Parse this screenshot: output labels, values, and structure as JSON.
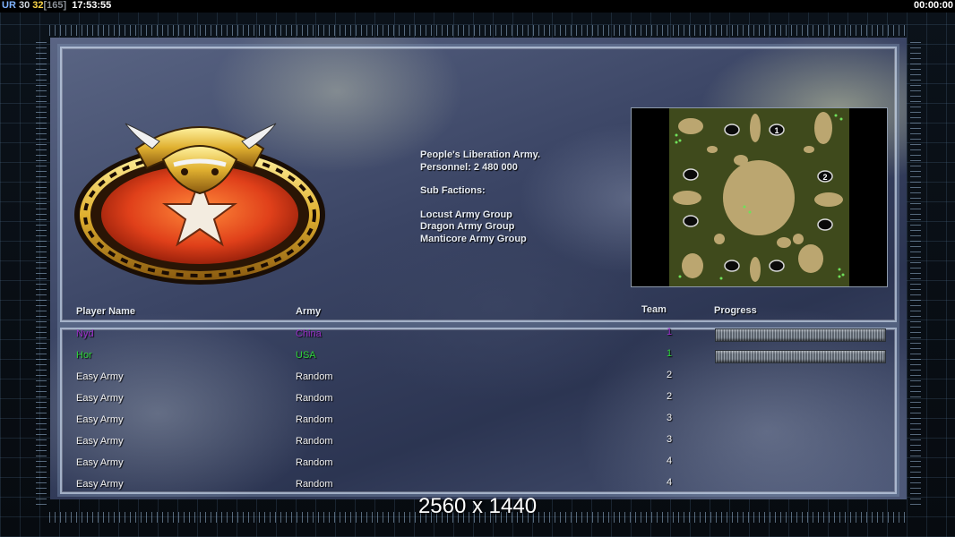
{
  "overlay": {
    "ur_label": "UR",
    "fps": "30",
    "fps_cap": "32",
    "cap_bracket": "[165]",
    "clock": "17:53:55",
    "game_timer": "00:00:00"
  },
  "faction": {
    "name": "People's Liberation Army.",
    "personnel": "Personnel: 2 480 000",
    "sub_factions_title": "Sub Factions:",
    "sub_factions": [
      "Locust Army Group",
      "Dragon Army Group",
      "Manticore Army Group"
    ]
  },
  "minimap": {
    "start_markers": [
      "1",
      "2"
    ]
  },
  "table": {
    "headers": {
      "player": "Player Name",
      "army": "Army",
      "team": "Team",
      "progress": "Progress"
    },
    "rows": [
      {
        "name": "Nyd",
        "army": "China",
        "team": "1",
        "color": "#9b2fc9",
        "progress": 1.0
      },
      {
        "name": "Hor",
        "army": "USA",
        "team": "1",
        "color": "#2fd43a",
        "progress": 1.0
      },
      {
        "name": "Easy Army",
        "army": "Random",
        "team": "2",
        "color": "#f2f2f2"
      },
      {
        "name": "Easy Army",
        "army": "Random",
        "team": "2",
        "color": "#f2f2f2"
      },
      {
        "name": "Easy Army",
        "army": "Random",
        "team": "3",
        "color": "#f2f2f2"
      },
      {
        "name": "Easy Army",
        "army": "Random",
        "team": "3",
        "color": "#f2f2f2"
      },
      {
        "name": "Easy Army",
        "army": "Random",
        "team": "4",
        "color": "#f2f2f2"
      },
      {
        "name": "Easy Army",
        "army": "Random",
        "team": "4",
        "color": "#f2f2f2"
      }
    ]
  },
  "resolution_label": "2560 x 1440",
  "colors": {
    "accent_frame": "#c8d7eb",
    "player_purple": "#9b2fc9",
    "player_green": "#2fd43a"
  }
}
